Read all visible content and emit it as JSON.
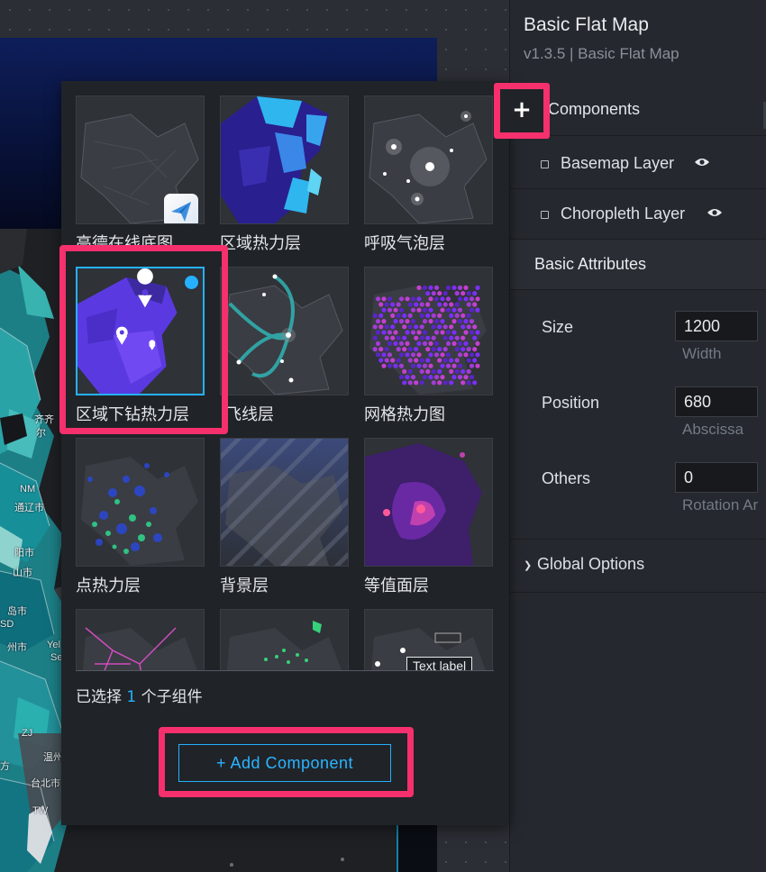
{
  "map": {
    "labels": [
      "NM",
      "通辽市",
      "阳市",
      "山市",
      "尔",
      "齐齐",
      "SD",
      "岛市",
      "州市",
      "Yel",
      "Se",
      "温州",
      "TW",
      "台北市",
      "方",
      "ZJ"
    ]
  },
  "right_panel": {
    "title": "Basic Flat Map",
    "subtitle": "v1.3.5 | Basic Flat Map",
    "components_label": "Components",
    "layers": [
      {
        "label": "Basemap Layer",
        "icon": "eye-icon"
      },
      {
        "label": "Choropleth Layer",
        "icon": "eye-icon"
      }
    ],
    "basic_attributes_label": "Basic Attributes",
    "attributes": [
      {
        "label": "Size",
        "value": "1200",
        "sub": "Width"
      },
      {
        "label": "Position",
        "value": "680",
        "sub": "Abscissa"
      },
      {
        "label": "Others",
        "value": "0",
        "sub": "Rotation Ar"
      }
    ],
    "global_options_label": "Global Options"
  },
  "picker": {
    "tiles": [
      {
        "label": "高德在线底图"
      },
      {
        "label": "区域热力层"
      },
      {
        "label": "呼吸气泡层"
      },
      {
        "label": "区域下钻热力层",
        "selected": true
      },
      {
        "label": "飞线层"
      },
      {
        "label": "网格热力图"
      },
      {
        "label": "点热力层"
      },
      {
        "label": "背景层"
      },
      {
        "label": "等值面层"
      },
      {
        "label": ""
      },
      {
        "label": ""
      },
      {
        "label": ""
      }
    ],
    "text_label_chip": "Text label",
    "selection_prefix": "已选择",
    "selection_count": "1",
    "selection_suffix": "个子组件",
    "add_button_label": "+ Add Component",
    "plus_icon": "+"
  },
  "colors": {
    "accent": "#25b1ff",
    "highlight": "#f5306d",
    "panel_bg": "#25282e"
  }
}
